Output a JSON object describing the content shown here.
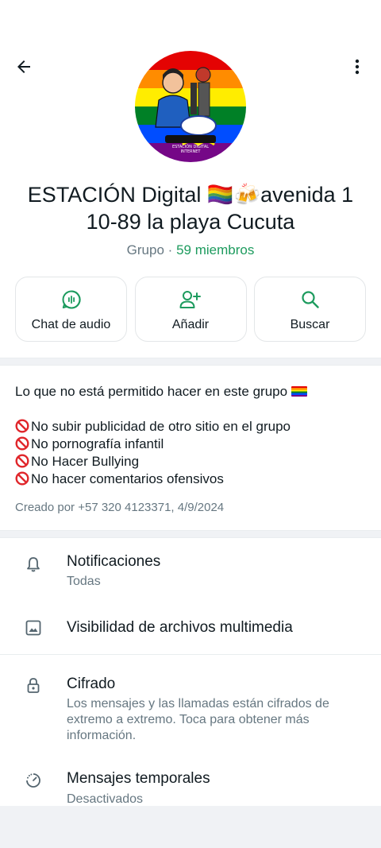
{
  "header": {
    "back_icon": "arrow-left-icon",
    "menu_icon": "more-vertical-icon"
  },
  "avatar": {
    "caption_line1": "ESTACIÓN DIGITAL",
    "caption_line2": "INTERNET"
  },
  "group": {
    "title": "ESTACIÓN Digital 🏳️‍🌈🍻avenida 1 10-89 la playa Cucuta",
    "type": "Grupo",
    "dot": "·",
    "members": "59 miembros"
  },
  "actions": [
    {
      "label": "Chat de audio",
      "icon": "audio-chat-icon"
    },
    {
      "label": "Añadir",
      "icon": "add-person-icon"
    },
    {
      "label": "Buscar",
      "icon": "search-icon"
    }
  ],
  "description": {
    "intro": "Lo que no está permitido hacer en este grupo",
    "rules": [
      "No subir publicidad de otro sitio en el grupo",
      "No pornografía infantil",
      "No Hacer Bullying",
      "No hacer comentarios ofensivos"
    ],
    "created": "Creado por +57 320 4123371, 4/9/2024"
  },
  "settings": [
    {
      "title": "Notificaciones",
      "subtitle": "Todas",
      "icon": "bell-icon"
    },
    {
      "title": "Visibilidad de archivos multimedia",
      "subtitle": "",
      "icon": "image-icon"
    },
    {
      "title": "Cifrado",
      "subtitle": "Los mensajes y las llamadas están cifrados de extremo a extremo. Toca para obtener más información.",
      "icon": "lock-icon"
    },
    {
      "title": "Mensajes temporales",
      "subtitle": "Desactivados",
      "icon": "timer-icon"
    }
  ],
  "colors": {
    "accent": "#1d9b5e",
    "text": "#111b21",
    "secondary": "#667781"
  }
}
